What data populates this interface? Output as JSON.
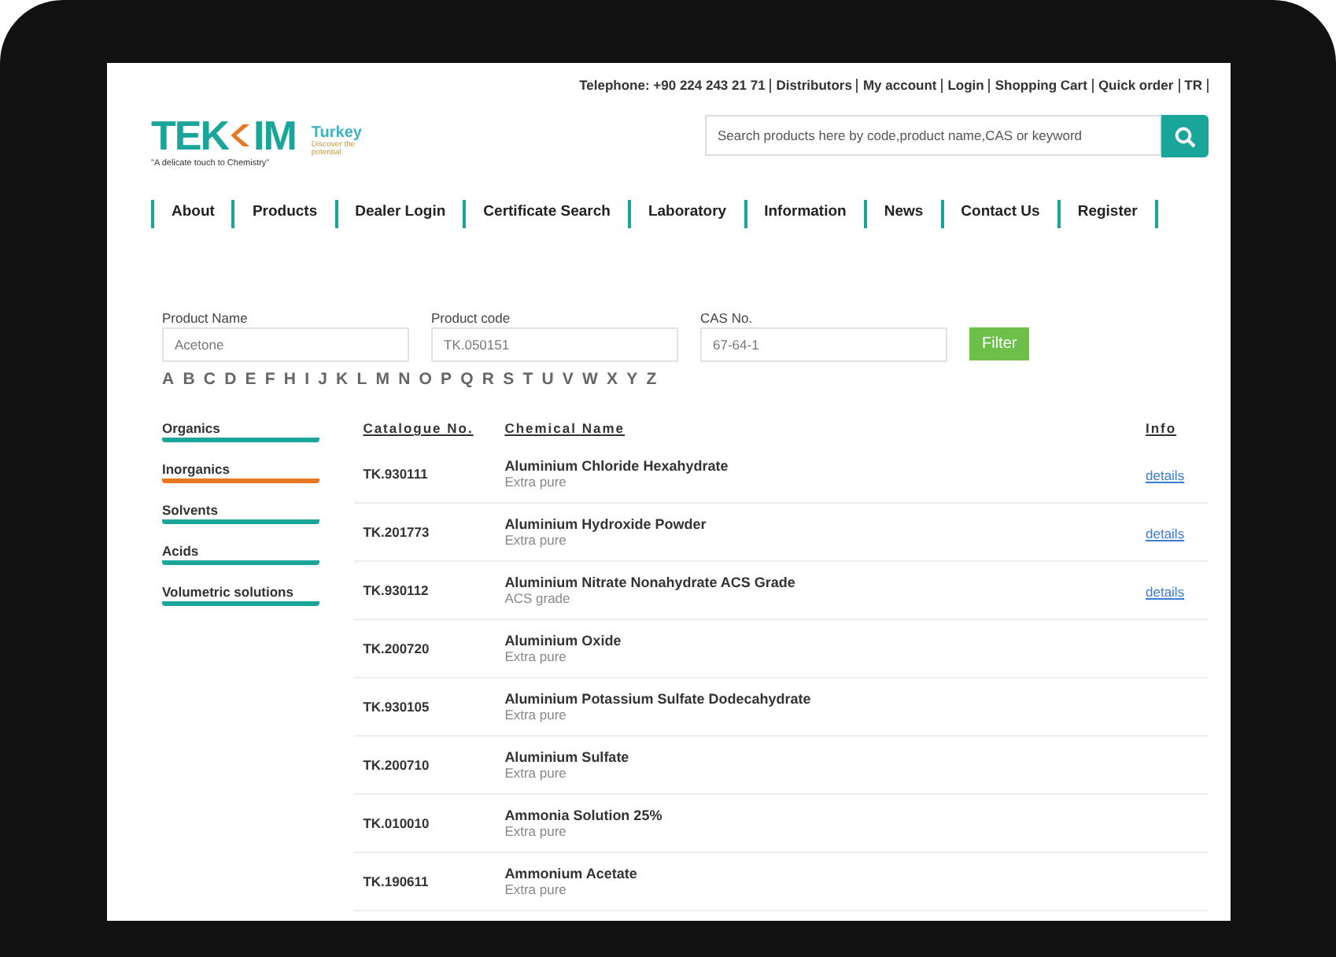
{
  "top_links": [
    "Telephone: +90 224 243 21 71",
    "Distributors",
    "My account",
    "Login",
    "Shopping Cart",
    "Quick order",
    "TR"
  ],
  "logo": {
    "word_start": "TEK",
    "word_end": "IM",
    "tagline": "\"A delicate touch to Chemistry\"",
    "country": "Turkey",
    "slogan": "Discover the potential"
  },
  "search": {
    "placeholder": "Search products here by code,product name,CAS or keyword"
  },
  "nav": [
    "About",
    "Products",
    "Dealer Login",
    "Certificate Search",
    "Laboratory",
    "Information",
    "News",
    "Contact Us",
    "Register"
  ],
  "filters": [
    {
      "label": "Product Name",
      "placeholder": "Acetone"
    },
    {
      "label": "Product code",
      "placeholder": "TK.050151"
    },
    {
      "label": "CAS No.",
      "placeholder": "67-64-1"
    }
  ],
  "filter_button": "Filter",
  "letters": [
    "A",
    "B",
    "C",
    "D",
    "E",
    "F",
    "H",
    "I",
    "J",
    "K",
    "L",
    "M",
    "N",
    "O",
    "P",
    "Q",
    "R",
    "S",
    "T",
    "U",
    "V",
    "W",
    "X",
    "Y",
    "Z"
  ],
  "categories": [
    {
      "label": "Organics",
      "color": "#1aa59a"
    },
    {
      "label": "Inorganics",
      "color": "#e87722"
    },
    {
      "label": "Solvents",
      "color": "#1aa59a"
    },
    {
      "label": "Acids",
      "color": "#1aa59a"
    },
    {
      "label": "Volumetric solutions",
      "color": "#1aa59a"
    }
  ],
  "table": {
    "columns": [
      "Catalogue No.",
      "Chemical Name",
      "Info"
    ],
    "rows": [
      {
        "code": "TK.930111",
        "name": "Aluminium Chloride Hexahydrate",
        "grade": "Extra pure",
        "info": "details"
      },
      {
        "code": "TK.201773",
        "name": "Aluminium Hydroxide Powder",
        "grade": "Extra pure",
        "info": "details"
      },
      {
        "code": "TK.930112",
        "name": "Aluminium Nitrate Nonahydrate ACS Grade",
        "grade": "ACS grade",
        "info": "details"
      },
      {
        "code": "TK.200720",
        "name": "Aluminium Oxide",
        "grade": "Extra pure"
      },
      {
        "code": "TK.930105",
        "name": "Aluminium Potassium Sulfate Dodecahydrate",
        "grade": "Extra pure"
      },
      {
        "code": "TK.200710",
        "name": "Aluminium Sulfate",
        "grade": "Extra pure"
      },
      {
        "code": "TK.010010",
        "name": "Ammonia Solution 25%",
        "grade": "Extra pure"
      },
      {
        "code": "TK.190611",
        "name": "Ammonium Acetate",
        "grade": "Extra pure"
      }
    ]
  }
}
